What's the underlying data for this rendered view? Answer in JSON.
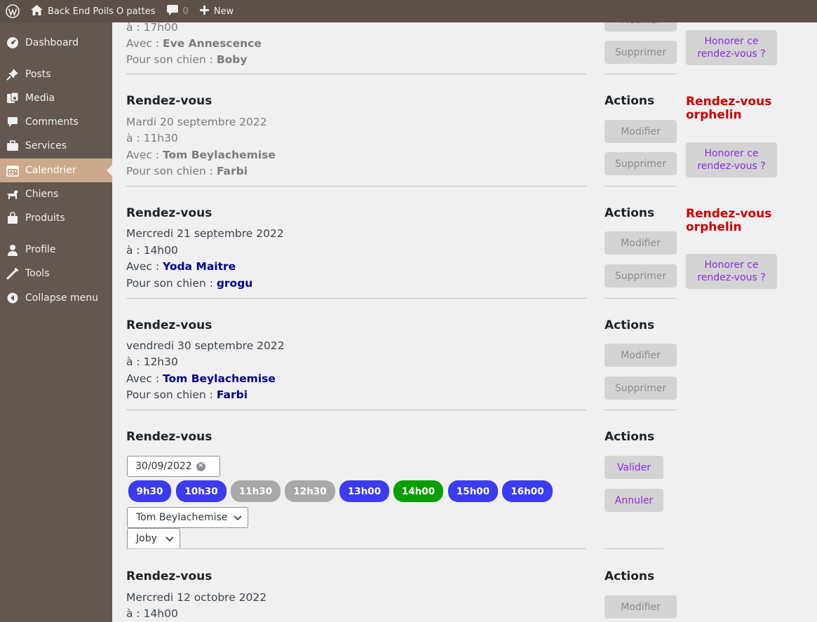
{
  "adminbar": {
    "site_name": "Back End Poils O pattes",
    "comments_count": "0",
    "new_label": "New"
  },
  "sidebar": {
    "items": [
      {
        "label": "Dashboard",
        "icon": "dashboard-icon"
      },
      {
        "label": "Posts",
        "icon": "pin-icon"
      },
      {
        "label": "Media",
        "icon": "media-icon"
      },
      {
        "label": "Comments",
        "icon": "comment-icon"
      },
      {
        "label": "Services",
        "icon": "briefcase-icon"
      },
      {
        "label": "Calendrier",
        "icon": "calendar-icon",
        "current": true
      },
      {
        "label": "Chiens",
        "icon": "dog-icon"
      },
      {
        "label": "Produits",
        "icon": "shopping-bag-icon"
      },
      {
        "label": "Profile",
        "icon": "user-icon"
      },
      {
        "label": "Tools",
        "icon": "wrench-icon"
      },
      {
        "label": "Collapse menu",
        "icon": "collapse-icon"
      }
    ]
  },
  "labels": {
    "rdv_title": "Rendez-vous",
    "actions_title": "Actions",
    "at_prefix": "à : ",
    "with_prefix": "Avec : ",
    "dog_prefix": "Pour son chien : ",
    "modify": "Modifier",
    "delete": "Supprimer",
    "honor": "Honorer ce rendez-vous ?",
    "orphan": "Rendez-vous orphelin",
    "validate": "Valider",
    "cancel": "Annuler"
  },
  "appointments": [
    {
      "time": "17h00",
      "person": "Eve Annescence",
      "dog": "Boby",
      "state": "past"
    },
    {
      "date": "Mardi 20 septembre 2022",
      "time": "11h30",
      "person": "Tom Beylachemise",
      "dog": "Farbi",
      "state": "past"
    },
    {
      "date": "Mercredi 21 septembre 2022",
      "time": "14h00",
      "person": "Yoda Maitre",
      "dog": "grogu",
      "state": "upcoming"
    },
    {
      "date": "vendredi 30 septembre 2022",
      "time": "12h30",
      "person": "Tom Beylachemise",
      "dog": "Farbi",
      "state": "upcoming"
    },
    {
      "date": "Mercredi 12 octobre 2022",
      "time": "14h00",
      "state": "upcoming"
    }
  ],
  "edit_form": {
    "date_value": "30/09/2022",
    "slots": [
      {
        "label": "9h30",
        "state": "available"
      },
      {
        "label": "10h30",
        "state": "available"
      },
      {
        "label": "11h30",
        "state": "taken"
      },
      {
        "label": "12h30",
        "state": "taken"
      },
      {
        "label": "13h00",
        "state": "available"
      },
      {
        "label": "14h00",
        "state": "selected"
      },
      {
        "label": "15h00",
        "state": "available"
      },
      {
        "label": "16h00",
        "state": "available"
      }
    ],
    "person_select": "Tom Beylachemise",
    "dog_select": "Joby"
  },
  "colors": {
    "sidebar_bg": "#645750",
    "adminbar_bg": "#5c5048",
    "current_item_bg": "#cba98a",
    "slot_available": "#3b3bef",
    "slot_taken": "#a8a8a8",
    "slot_selected": "#0a9e00",
    "orphan_red": "#cc0000",
    "link_navy": "#00008b",
    "purple": "#8a2be2"
  }
}
